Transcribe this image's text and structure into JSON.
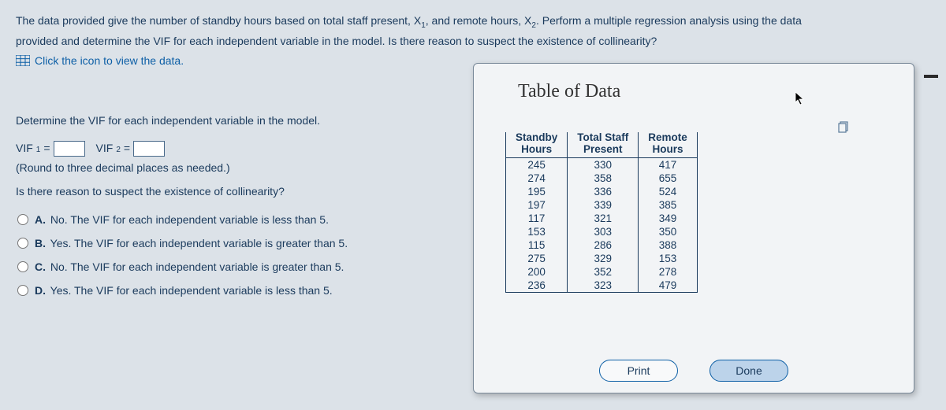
{
  "problem": {
    "line1_a": "The data provided give the number of standby hours based on total staff present, X",
    "line1_b": ", and remote hours, X",
    "line1_c": ". Perform a multiple regression analysis using the data",
    "line2": "provided and determine the VIF for each independent variable in the model. Is there reason to suspect the existence of collinearity?",
    "sub1": "1",
    "sub2": "2"
  },
  "link": {
    "label": "Click the icon to view the data."
  },
  "section": {
    "determine": "Determine the VIF for each independent variable in the model.",
    "vif1_label": "VIF",
    "vif1_sub": "1",
    "equals": "=",
    "vif2_label": "VIF",
    "vif2_sub": "2",
    "hint": "(Round to three decimal places as needed.)",
    "question2": "Is there reason to suspect the existence of collinearity?"
  },
  "options": [
    {
      "letter": "A.",
      "text": "No. The VIF for each independent variable is less than 5."
    },
    {
      "letter": "B.",
      "text": "Yes. The VIF for each independent variable is greater than 5."
    },
    {
      "letter": "C.",
      "text": "No. The VIF for each independent variable is greater than 5."
    },
    {
      "letter": "D.",
      "text": "Yes. The VIF for each independent variable is less than 5."
    }
  ],
  "modal": {
    "title": "Table of Data",
    "headers": {
      "c1a": "Standby",
      "c1b": "Hours",
      "c2a": "Total Staff",
      "c2b": "Present",
      "c3a": "Remote",
      "c3b": "Hours"
    },
    "rows": [
      [
        "245",
        "330",
        "417"
      ],
      [
        "274",
        "358",
        "655"
      ],
      [
        "195",
        "336",
        "524"
      ],
      [
        "197",
        "339",
        "385"
      ],
      [
        "117",
        "321",
        "349"
      ],
      [
        "153",
        "303",
        "350"
      ],
      [
        "115",
        "286",
        "388"
      ],
      [
        "275",
        "329",
        "153"
      ],
      [
        "200",
        "352",
        "278"
      ],
      [
        "236",
        "323",
        "479"
      ]
    ],
    "buttons": {
      "print": "Print",
      "done": "Done"
    }
  }
}
